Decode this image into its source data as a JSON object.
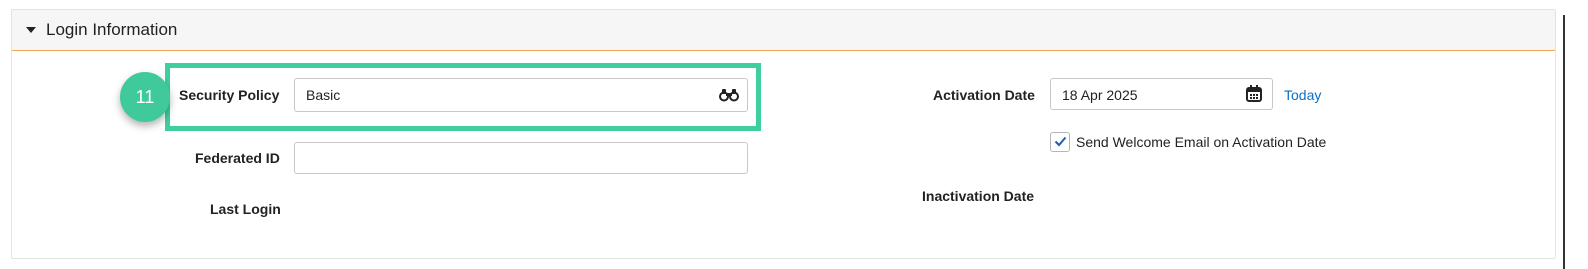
{
  "section": {
    "title": "Login Information"
  },
  "step_badge": "11",
  "fields": {
    "security_policy": {
      "label": "Security Policy",
      "value": "Basic"
    },
    "federated_id": {
      "label": "Federated ID",
      "value": ""
    },
    "last_login": {
      "label": "Last Login"
    },
    "activation_date": {
      "label": "Activation Date",
      "value": "18 Apr 2025",
      "today_link": "Today"
    },
    "send_welcome": {
      "label": "Send Welcome Email on Activation Date",
      "checked": true
    },
    "inactivation_date": {
      "label": "Inactivation Date"
    }
  },
  "colors": {
    "highlight": "#3fcf9c",
    "badge": "#40c99a",
    "header_underline": "#f0a65a",
    "link": "#0b6fc7",
    "checkmark": "#1a5fb4"
  },
  "icons": {
    "collapse": "caret-down-icon",
    "lookup": "binoculars-icon",
    "calendar": "calendar-icon",
    "check": "checkmark-icon"
  }
}
